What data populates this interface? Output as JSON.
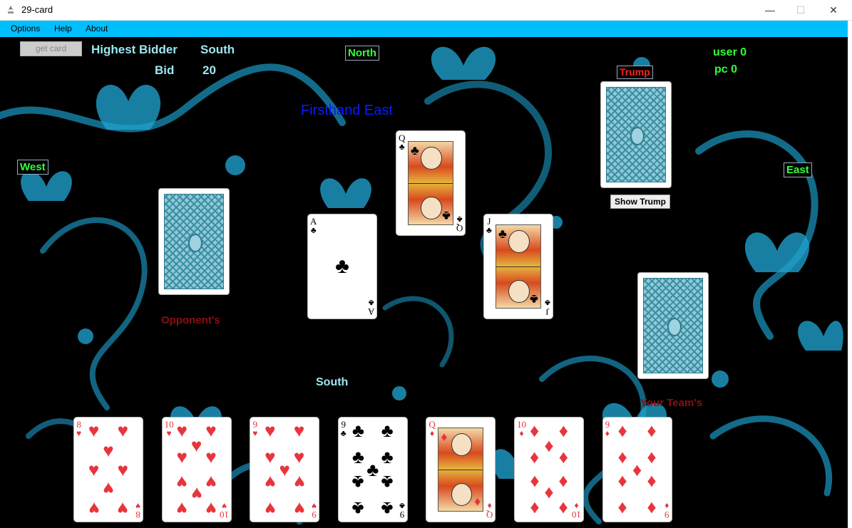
{
  "window": {
    "title": "29-card",
    "minimize_glyph": "—",
    "maximize_glyph": "☐",
    "close_glyph": "✕"
  },
  "menu": [
    "Options",
    "Help",
    "About"
  ],
  "controls": {
    "get_card_label": "get card",
    "show_trump_label": "Show Trump"
  },
  "info": {
    "highest_bidder_label": "Highest Bidder",
    "highest_bidder_value": "South",
    "bid_label": "Bid",
    "bid_value": "20",
    "firsthand_text": "Firsthand East"
  },
  "players": {
    "north": "North",
    "south": "South",
    "west": "West",
    "east": "East"
  },
  "scores": {
    "user": "user 0",
    "pc": "pc 0"
  },
  "trump_label": "Trump",
  "piles": {
    "opponents": "Opponent's",
    "your_team": "Your Team's"
  },
  "colors": {
    "cyan_text": "#9ee7f0",
    "green_label": "#32ff3a",
    "red_label": "#ff2020",
    "dark_red": "#8b1010",
    "suit_red": "#e8353c",
    "suit_black": "#000000",
    "menubar": "#00bfff"
  },
  "played_cards": [
    {
      "rank": "A",
      "suit": "♣",
      "color": "black",
      "position": "west-trick"
    },
    {
      "rank": "Q",
      "suit": "♣",
      "color": "black",
      "position": "north-trick"
    },
    {
      "rank": "J",
      "suit": "♣",
      "color": "black",
      "position": "east-trick"
    }
  ],
  "hand": [
    {
      "rank": "8",
      "suit": "♥",
      "color": "red"
    },
    {
      "rank": "10",
      "suit": "♥",
      "color": "red"
    },
    {
      "rank": "9",
      "suit": "♥",
      "color": "red"
    },
    {
      "rank": "9",
      "suit": "♣",
      "color": "black"
    },
    {
      "rank": "Q",
      "suit": "♦",
      "color": "red"
    },
    {
      "rank": "10",
      "suit": "♦",
      "color": "red"
    },
    {
      "rank": "9",
      "suit": "♦",
      "color": "red"
    }
  ]
}
